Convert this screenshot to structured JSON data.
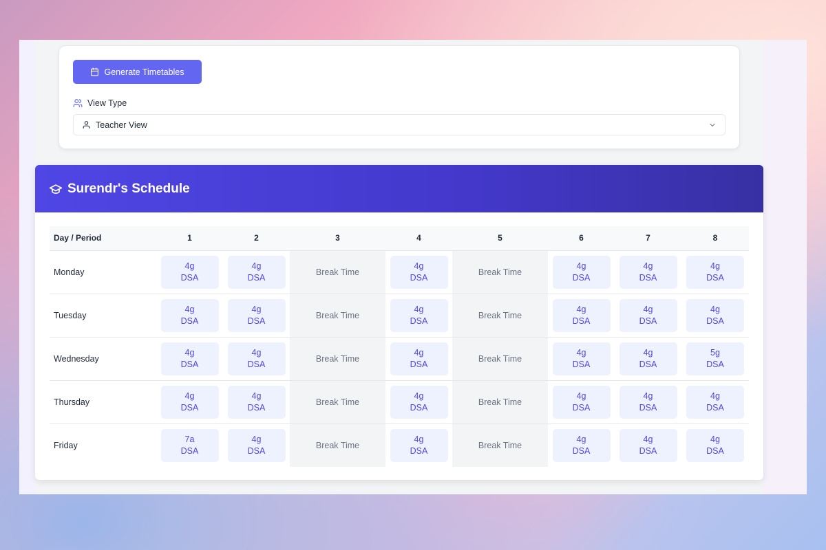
{
  "controls": {
    "generate_label": "Generate Timetables",
    "view_type_label": "View Type",
    "view_type_value": "Teacher View"
  },
  "schedule": {
    "title": "Surendr's Schedule",
    "header_day": "Day / Period",
    "periods": [
      "1",
      "2",
      "3",
      "4",
      "5",
      "6",
      "7",
      "8"
    ],
    "break_label": "Break Time",
    "rows": [
      {
        "day": "Monday",
        "slots": [
          [
            "4g",
            "DSA"
          ],
          [
            "4g",
            "DSA"
          ],
          "break",
          [
            "4g",
            "DSA"
          ],
          "break",
          [
            "4g",
            "DSA"
          ],
          [
            "4g",
            "DSA"
          ],
          [
            "4g",
            "DSA"
          ]
        ]
      },
      {
        "day": "Tuesday",
        "slots": [
          [
            "4g",
            "DSA"
          ],
          [
            "4g",
            "DSA"
          ],
          "break",
          [
            "4g",
            "DSA"
          ],
          "break",
          [
            "4g",
            "DSA"
          ],
          [
            "4g",
            "DSA"
          ],
          [
            "4g",
            "DSA"
          ]
        ]
      },
      {
        "day": "Wednesday",
        "slots": [
          [
            "4g",
            "DSA"
          ],
          [
            "4g",
            "DSA"
          ],
          "break",
          [
            "4g",
            "DSA"
          ],
          "break",
          [
            "4g",
            "DSA"
          ],
          [
            "4g",
            "DSA"
          ],
          [
            "5g",
            "DSA"
          ]
        ]
      },
      {
        "day": "Thursday",
        "slots": [
          [
            "4g",
            "DSA"
          ],
          [
            "4g",
            "DSA"
          ],
          "break",
          [
            "4g",
            "DSA"
          ],
          "break",
          [
            "4g",
            "DSA"
          ],
          [
            "4g",
            "DSA"
          ],
          [
            "4g",
            "DSA"
          ]
        ]
      },
      {
        "day": "Friday",
        "slots": [
          [
            "7a",
            "DSA"
          ],
          [
            "4g",
            "DSA"
          ],
          "break",
          [
            "4g",
            "DSA"
          ],
          "break",
          [
            "4g",
            "DSA"
          ],
          [
            "4g",
            "DSA"
          ],
          [
            "4g",
            "DSA"
          ]
        ]
      }
    ]
  },
  "colors": {
    "accent": "#6366f1",
    "header_gradient_start": "#4f46e5",
    "header_gradient_end": "#3730a3",
    "slot_bg": "#eef2ff",
    "slot_text": "#4f46e5",
    "break_bg": "#f3f4f6"
  },
  "icons": {
    "generate": "calendar-icon",
    "view_type": "users-icon",
    "select_person": "user-icon",
    "select_chevron": "chevron-down-icon",
    "schedule_title": "graduation-cap-icon"
  }
}
